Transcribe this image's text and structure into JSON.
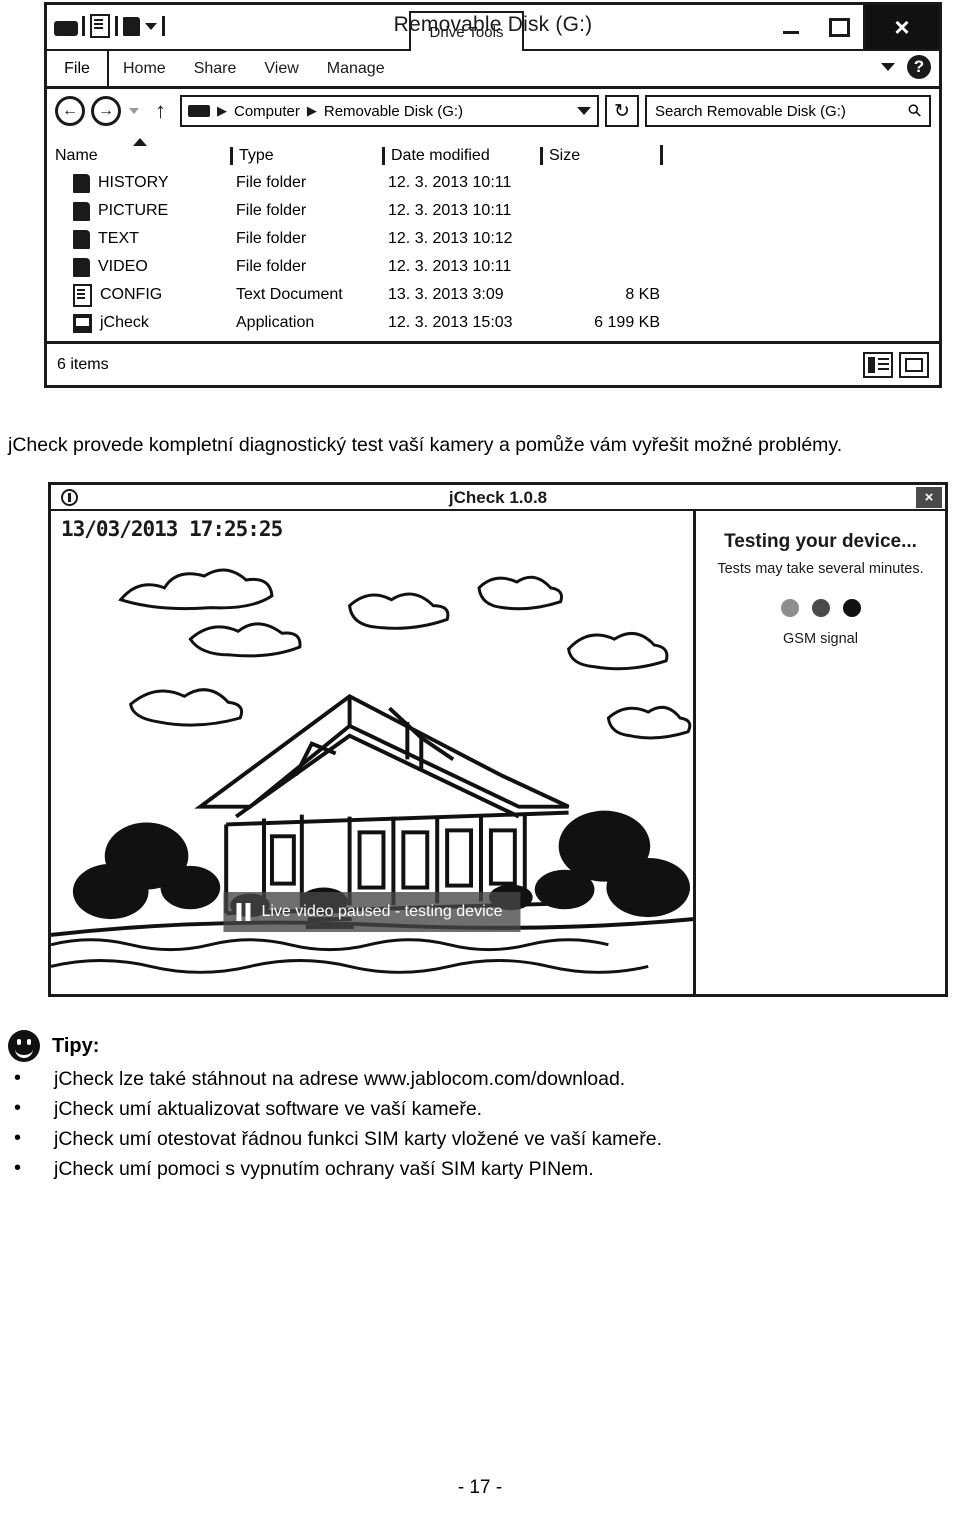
{
  "explorer": {
    "quick_access": {
      "drive_icon": "drive-icon",
      "doc_icon": "document-icon",
      "folder_icon": "folder-icon",
      "dropdown_icon": "chevron-down-icon"
    },
    "contextual_tab_group": "Drive Tools",
    "title": "Removable Disk (G:)",
    "window_buttons": {
      "minimize": "minimize-icon",
      "maximize": "maximize-icon",
      "close": "×"
    },
    "ribbon": {
      "file": "File",
      "tabs": [
        "Home",
        "Share",
        "View",
        "Manage"
      ],
      "collapse": "chevron-down-icon",
      "help": "?"
    },
    "nav": {
      "back": "←",
      "forward": "→",
      "recent": "chevron-down-icon",
      "up": "↑",
      "breadcrumb": [
        "Computer",
        "Removable Disk (G:)"
      ],
      "breadcrumb_separator": "▶",
      "address_dropdown": "chevron-down-icon",
      "refresh": "↻",
      "search_placeholder": "Search Removable Disk (G:)",
      "search_icon": "search-icon"
    },
    "columns": [
      "Name",
      "Type",
      "Date modified",
      "Size"
    ],
    "sort_indicator": "sort-ascending-icon",
    "rows": [
      {
        "icon": "folder-icon",
        "name": "HISTORY",
        "type": "File folder",
        "date": "12. 3. 2013 10:11",
        "size": ""
      },
      {
        "icon": "folder-icon",
        "name": "PICTURE",
        "type": "File folder",
        "date": "12. 3. 2013 10:11",
        "size": ""
      },
      {
        "icon": "folder-icon",
        "name": "TEXT",
        "type": "File folder",
        "date": "12. 3. 2013 10:12",
        "size": ""
      },
      {
        "icon": "folder-icon",
        "name": "VIDEO",
        "type": "File folder",
        "date": "12. 3. 2013 10:11",
        "size": ""
      },
      {
        "icon": "text-file-icon",
        "name": "CONFIG",
        "type": "Text Document",
        "date": "13. 3. 2013 3:09",
        "size": "8 KB"
      },
      {
        "icon": "app-icon",
        "name": "jCheck",
        "type": "Application",
        "date": "12. 3. 2013 15:03",
        "size": "6 199 KB"
      }
    ],
    "status": {
      "item_count": "6 items",
      "details_view": "details-view-icon",
      "large_icons_view": "large-icons-view-icon"
    }
  },
  "caption": "jCheck provede kompletní diagnostický test vaší kamery a pomůže vám vyřešit možné problémy.",
  "jcheck": {
    "logo": "camera-icon",
    "title": "jCheck 1.0.8",
    "close": "×",
    "video": {
      "timestamp": "13/03/2013 17:25:25",
      "overlay_icon": "pause-icon",
      "overlay_text": "Live video paused - testing device"
    },
    "panel": {
      "heading": "Testing your device...",
      "subheading": "Tests may take several minutes.",
      "dots": [
        "dim",
        "mid",
        "on"
      ],
      "signal_label": "GSM signal"
    }
  },
  "tips": {
    "icon": "smiley-icon",
    "title": "Tipy:",
    "items": [
      "jCheck lze také stáhnout na adrese www.jablocom.com/download.",
      "jCheck umí aktualizovat software ve vaší kameře.",
      "jCheck umí otestovat řádnou funkci SIM karty vložené ve vaší kameře.",
      "jCheck umí pomoci s vypnutím ochrany vaší SIM karty PINem."
    ]
  },
  "page_number": "- 17 -"
}
